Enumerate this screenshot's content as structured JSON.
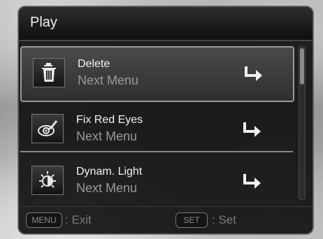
{
  "header": {
    "title": "Play"
  },
  "menu": {
    "items": [
      {
        "label": "Delete",
        "sub": "Next Menu",
        "icon": "trash-icon",
        "selected": true
      },
      {
        "label": "Fix Red Eyes",
        "sub": "Next Menu",
        "icon": "red-eye-icon",
        "selected": false
      },
      {
        "label": "Dynam. Light",
        "sub": "Next Menu",
        "icon": "dynamic-light-icon",
        "selected": false
      }
    ]
  },
  "footer": {
    "menu_key": "MENU",
    "menu_action": ": Exit",
    "set_key": "SET",
    "set_action": ": Set"
  },
  "colors": {
    "panel": "#121212",
    "selection_border": "#9a9a9a",
    "label_text": "#f4f4f4",
    "sub_text": "#9a9a9a"
  }
}
